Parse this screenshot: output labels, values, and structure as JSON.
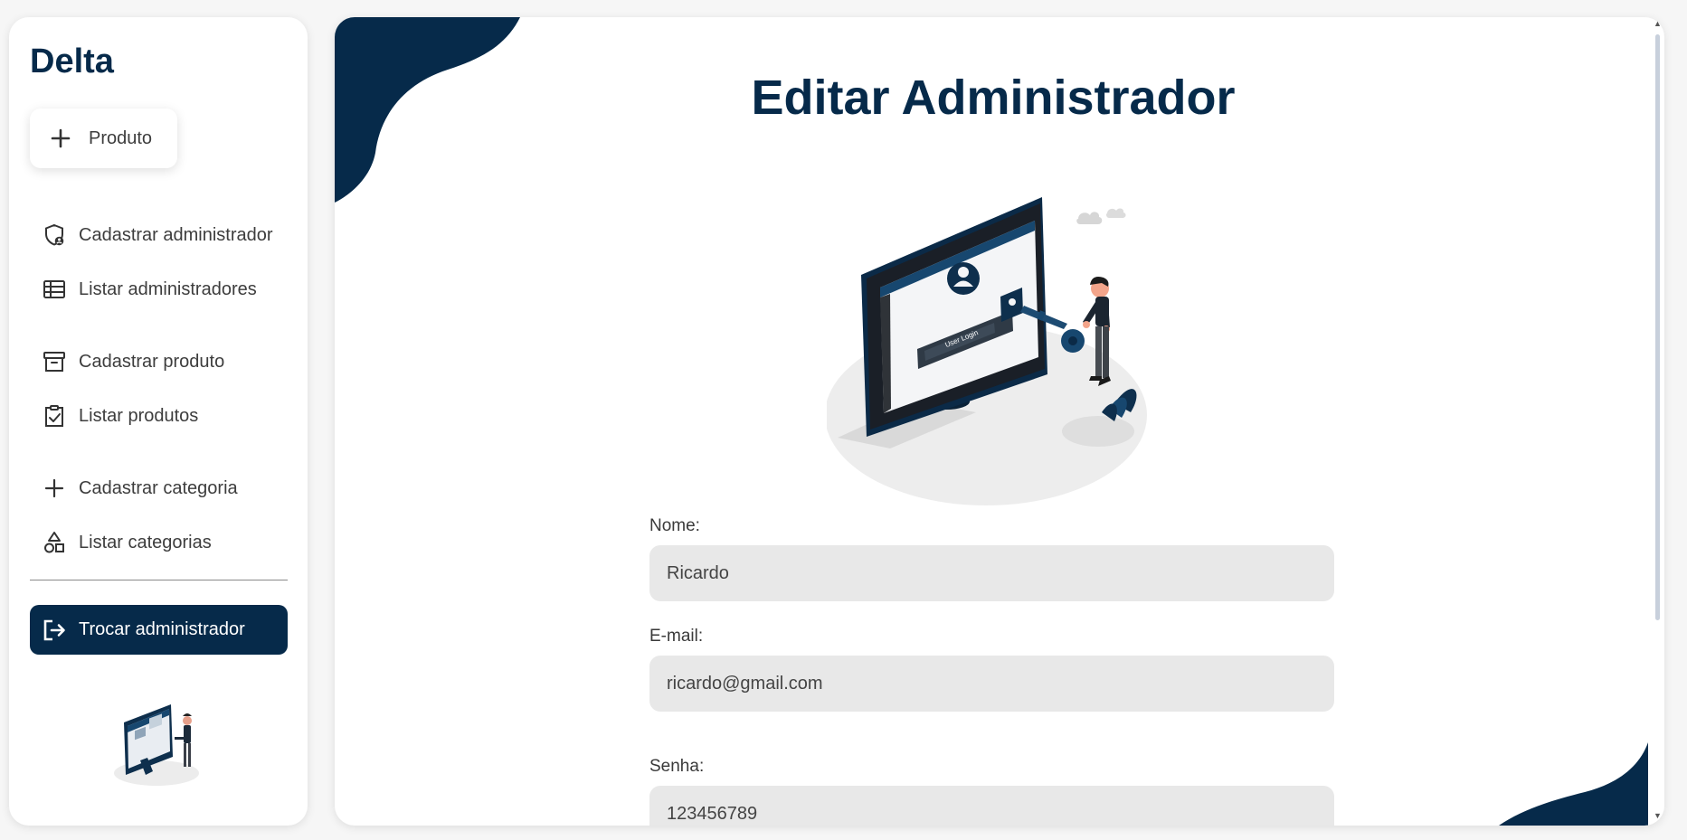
{
  "app": {
    "brand": "Delta"
  },
  "sidebar": {
    "add_button": {
      "label": "Produto",
      "icon": "plus-icon"
    },
    "items": [
      {
        "label": "Cadastrar administrador",
        "icon": "shield-icon"
      },
      {
        "label": "Listar administradores",
        "icon": "table-list-icon"
      },
      {
        "label": "Cadastrar produto",
        "icon": "archive-box-icon"
      },
      {
        "label": "Listar produtos",
        "icon": "clipboard-check-icon"
      },
      {
        "label": "Cadastrar categoria",
        "icon": "plus-icon"
      },
      {
        "label": "Listar categorias",
        "icon": "shapes-icon"
      }
    ],
    "switch_button": {
      "label": "Trocar administrador",
      "icon": "logout-icon"
    }
  },
  "main": {
    "title": "Editar Administrador",
    "hero_text": "User Login",
    "fields": [
      {
        "label": "Nome:",
        "value": "Ricardo"
      },
      {
        "label": "E-mail:",
        "value": "ricardo@gmail.com"
      },
      {
        "label": "Senha:",
        "value": "123456789"
      }
    ]
  },
  "colors": {
    "primary": "#062a4a",
    "input_bg": "#e8e8e8",
    "background": "#f6f6f6"
  }
}
